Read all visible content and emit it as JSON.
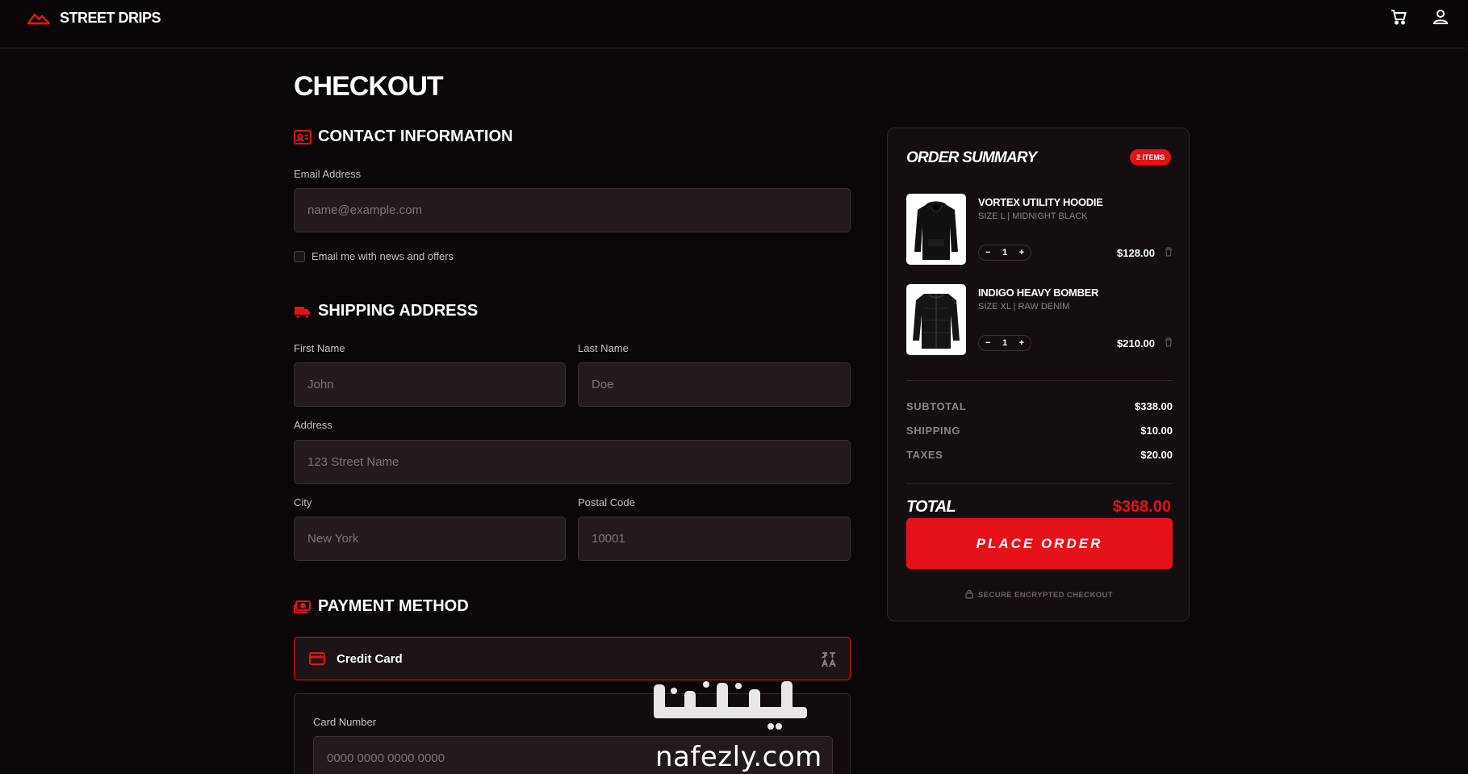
{
  "header": {
    "brand_name": "STREET DRIPS",
    "icons": {
      "logo": "mountain-logo-icon",
      "cart": "cart-icon",
      "account": "user-icon"
    }
  },
  "checkout": {
    "title": "CHECKOUT",
    "contact": {
      "title": "CONTACT INFORMATION",
      "email_label": "Email Address",
      "email_placeholder": "name@example.com",
      "newsletter_label": "Email me with news and offers"
    },
    "shipping": {
      "title": "SHIPPING ADDRESS",
      "first_name_label": "First Name",
      "first_name_placeholder": "John",
      "last_name_label": "Last Name",
      "last_name_placeholder": "Doe",
      "address_label": "Address",
      "address_placeholder": "123 Street Name",
      "city_label": "City",
      "city_placeholder": "New York",
      "postal_label": "Postal Code",
      "postal_placeholder": "10001"
    },
    "payment": {
      "title": "PAYMENT METHOD",
      "selected_option": "Credit Card",
      "card_number_label": "Card Number",
      "card_number_placeholder": "0000 0000 0000 0000"
    }
  },
  "summary": {
    "title": "ORDER SUMMARY",
    "badge": "2 ITEMS",
    "items": [
      {
        "name": "VORTEX UTILITY HOODIE",
        "meta": "SIZE L | MIDNIGHT BLACK",
        "qty": "1",
        "price": "$128.00"
      },
      {
        "name": "INDIGO HEAVY BOMBER",
        "meta": "SIZE XL | RAW DENIM",
        "qty": "1",
        "price": "$210.00"
      }
    ],
    "subtotal_label": "SUBTOTAL",
    "subtotal_value": "$338.00",
    "shipping_label": "SHIPPING",
    "shipping_value": "$10.00",
    "taxes_label": "TAXES",
    "taxes_value": "$20.00",
    "total_label": "TOTAL",
    "total_value": "$368.00",
    "place_order": "PLACE ORDER",
    "secure_text": "SECURE ENCRYPTED CHECKOUT"
  },
  "colors": {
    "accent": "#e6121a",
    "background": "#0b0708",
    "field": "#221a1c"
  },
  "watermark": {
    "arabic": "نفذلي",
    "latin": "nafezly.com"
  }
}
